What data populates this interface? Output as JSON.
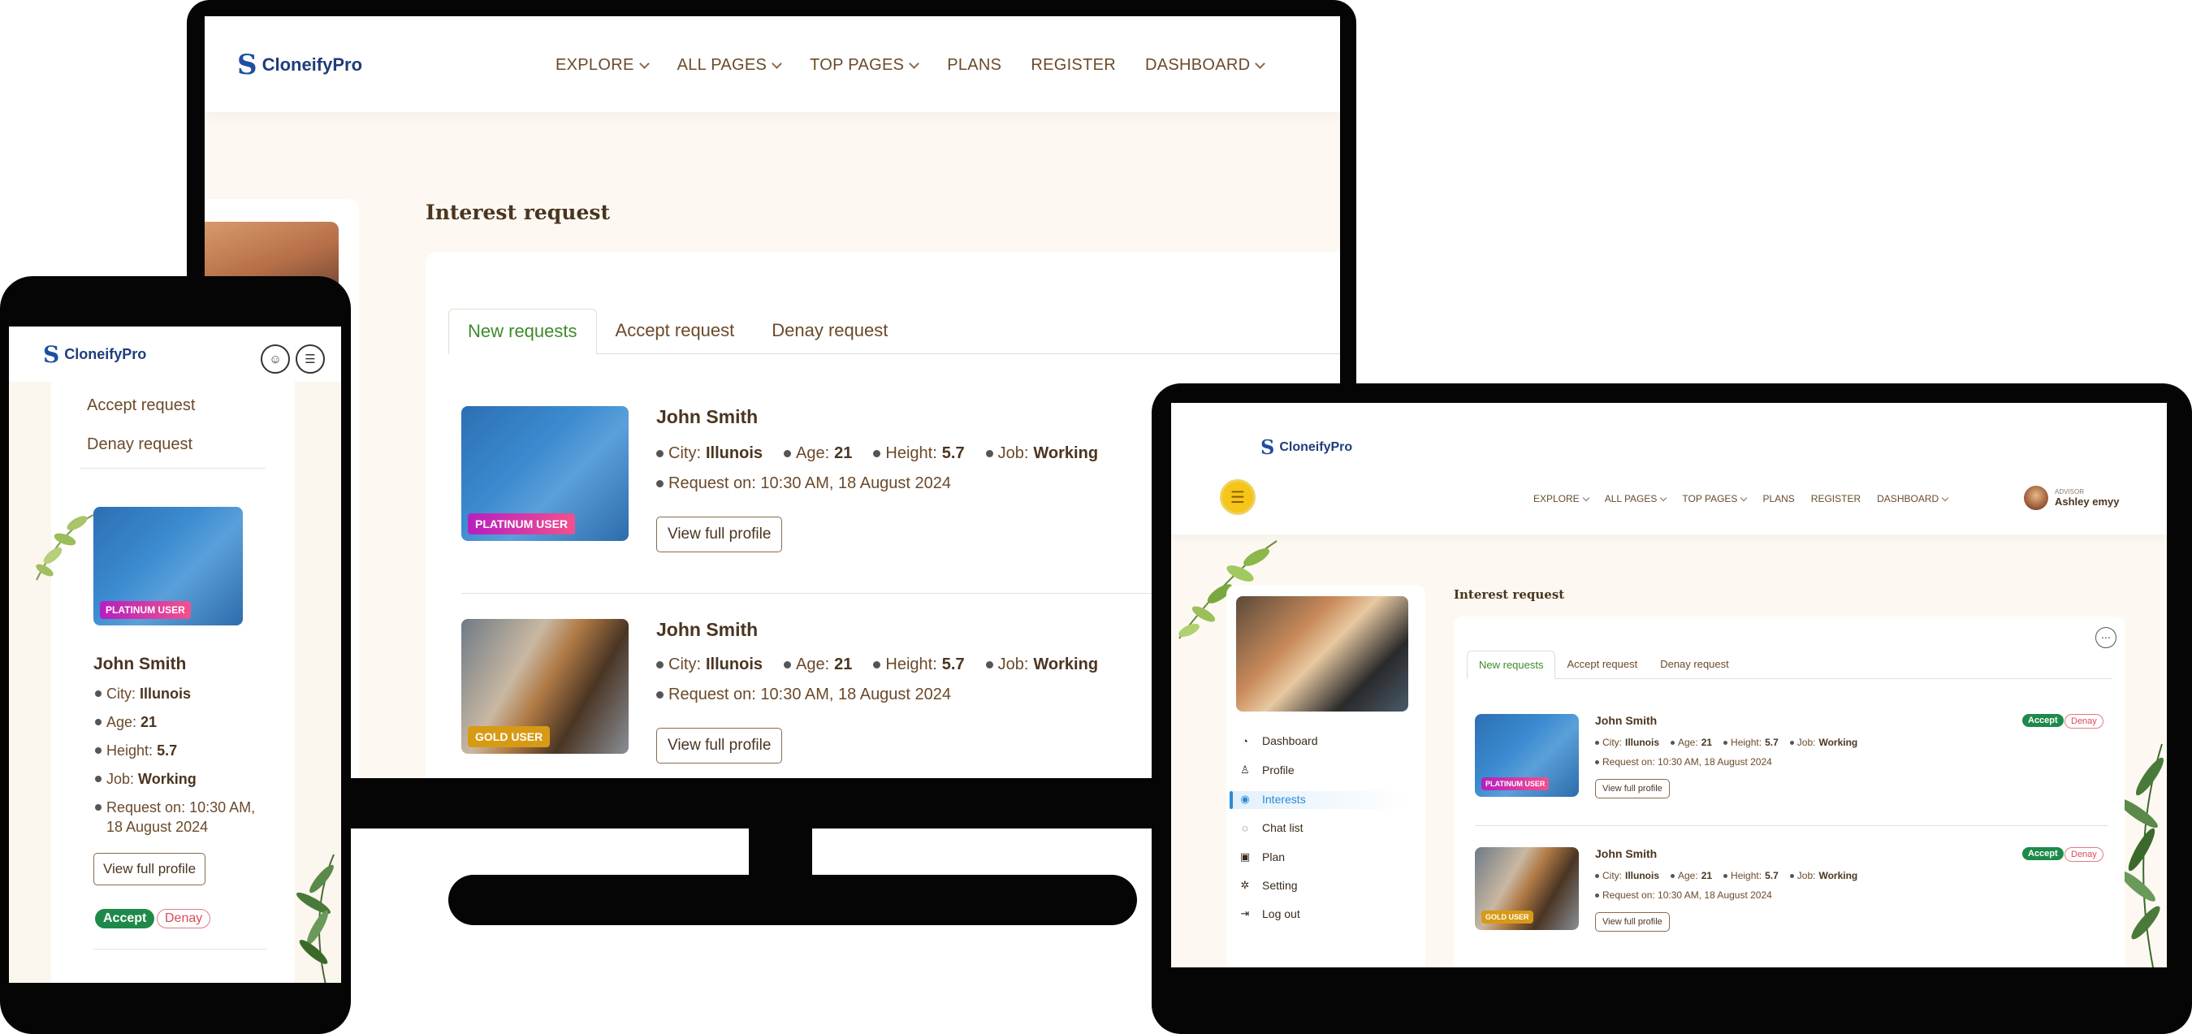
{
  "brand": {
    "name": "CloneifyPro",
    "mark": "S"
  },
  "nav": {
    "items": [
      {
        "label": "EXPLORE",
        "dropdown": true
      },
      {
        "label": "ALL PAGES",
        "dropdown": true
      },
      {
        "label": "TOP PAGES",
        "dropdown": true
      },
      {
        "label": "PLANS",
        "dropdown": false
      },
      {
        "label": "REGISTER",
        "dropdown": false
      },
      {
        "label": "DASHBOARD",
        "dropdown": true
      }
    ]
  },
  "page": {
    "title": "Interest request",
    "tabs": [
      "New requests",
      "Accept request",
      "Denay request"
    ],
    "active_tab": "New requests"
  },
  "requests": [
    {
      "name": "John Smith",
      "badge": "PLATINUM USER",
      "city_label": "City:",
      "city": "Illunois",
      "age_label": "Age:",
      "age": "21",
      "height_label": "Height:",
      "height": "5.7",
      "job_label": "Job:",
      "job": "Working",
      "request_on": "Request on: 10:30 AM, 18 August 2024",
      "request_on_line1": "Request on: 10:30 AM,",
      "request_on_line2": "18 August 2024",
      "view_label": "View full profile",
      "accept_label": "Accept",
      "deny_label": "Denay"
    },
    {
      "name": "John Smith",
      "badge": "GOLD USER",
      "city_label": "City:",
      "city": "Illunois",
      "age_label": "Age:",
      "age": "21",
      "height_label": "Height:",
      "height": "5.7",
      "job_label": "Job:",
      "job": "Working",
      "request_on": "Request on: 10:30 AM, 18 August 2024",
      "view_label": "View full profile",
      "accept_label": "Accept",
      "deny_label": "Denay"
    }
  ],
  "mobile": {
    "links": [
      "Accept request",
      "Denay request"
    ]
  },
  "tablet": {
    "user": {
      "role": "ADVISOR",
      "name": "Ashley emyy"
    },
    "menu": [
      {
        "label": "Dashboard",
        "icon": "dashboard-icon",
        "glyph": "◔"
      },
      {
        "label": "Profile",
        "icon": "person-icon",
        "glyph": "♙"
      },
      {
        "label": "Interests",
        "icon": "eye-icon",
        "glyph": "◉"
      },
      {
        "label": "Chat list",
        "icon": "chat-icon",
        "glyph": "◌"
      },
      {
        "label": "Plan",
        "icon": "plan-icon",
        "glyph": "▣"
      },
      {
        "label": "Setting",
        "icon": "gear-icon",
        "glyph": "✲"
      },
      {
        "label": "Log out",
        "icon": "logout-icon",
        "glyph": "⇥"
      }
    ],
    "active_menu": "Interests"
  },
  "colors": {
    "accent_green": "#3f8a2a",
    "accept_green": "#1e8a4a",
    "deny_red": "#d94a5a",
    "brand_blue": "#1e4fa0",
    "active_blue": "#2a8ad8",
    "burger_yellow": "#f5c518"
  }
}
